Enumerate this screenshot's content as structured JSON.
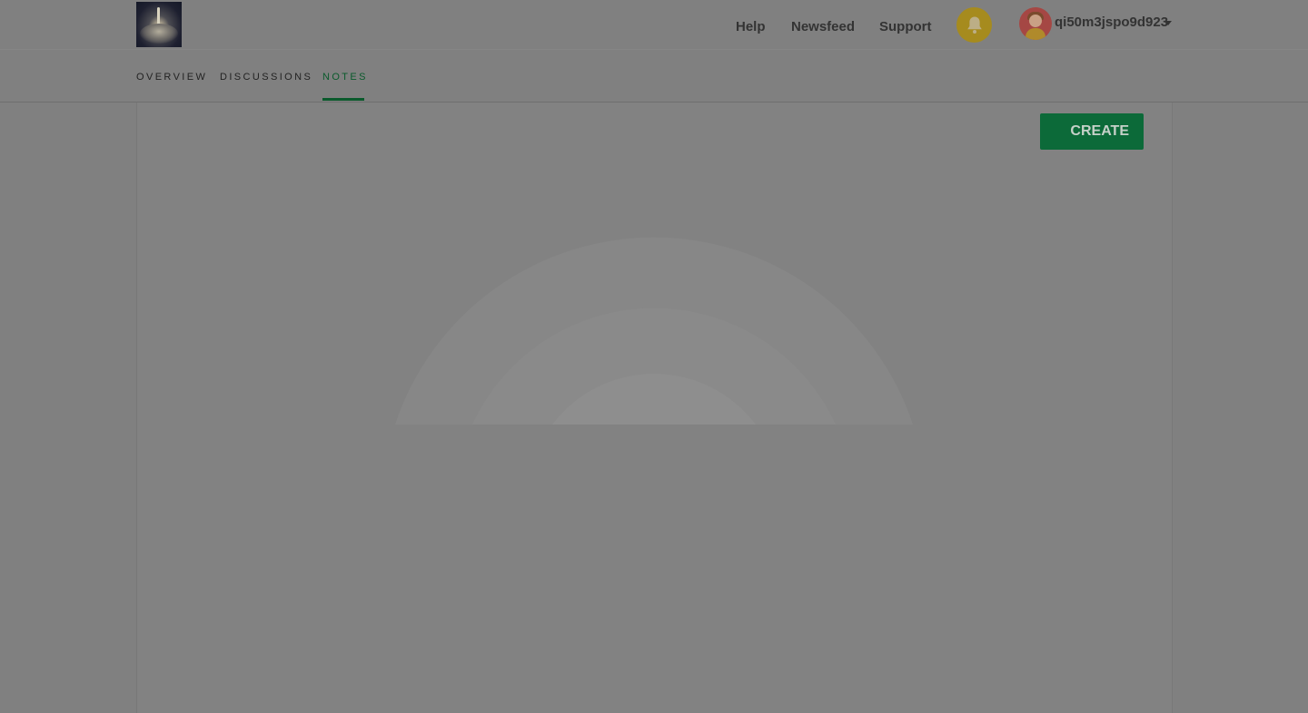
{
  "header": {
    "logo_name": "rocket-launch-logo",
    "nav": {
      "help": "Help",
      "newsfeed": "Newsfeed",
      "support": "Support"
    },
    "notification_icon": "bell-icon",
    "user": {
      "name": "qi50m3jspo9d923",
      "menu_icon": "chevron-down-icon"
    }
  },
  "tabs": {
    "overview": "OVERVIEW",
    "discussions": "DISCUSSIONS",
    "notes": "NOTES",
    "active": "NOTES"
  },
  "main": {
    "create_label": "CREATE"
  },
  "colors": {
    "overlay_background": "#808080",
    "accent_green": "#0c6a39",
    "active_tab": "#0a5a2c",
    "bell_background": "#a68b1e"
  }
}
